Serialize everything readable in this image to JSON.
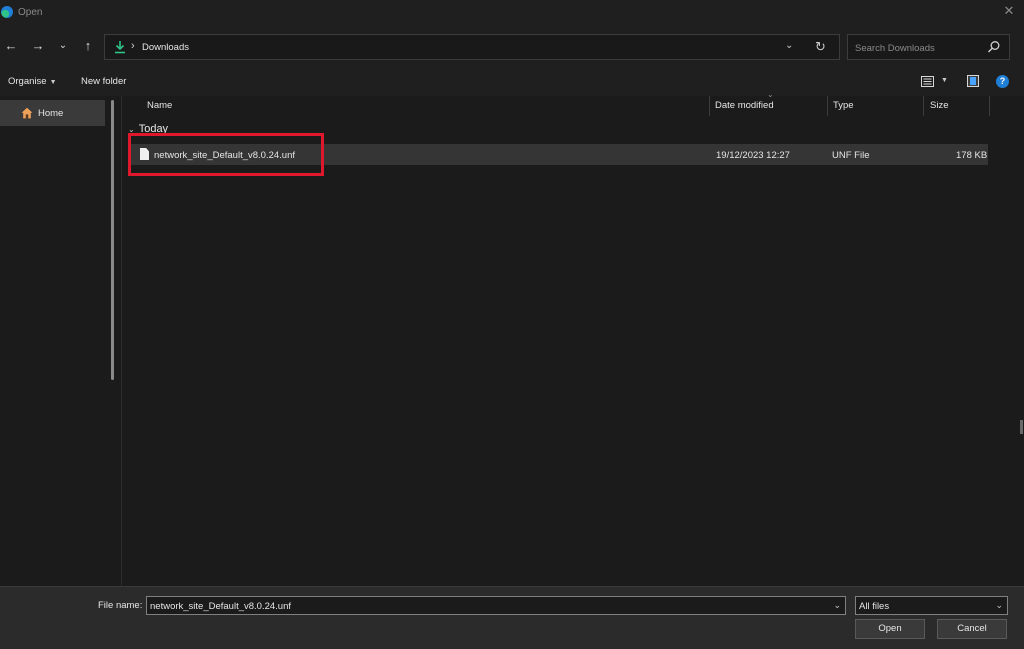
{
  "window": {
    "title": "Open"
  },
  "address_bar": {
    "location": "Downloads"
  },
  "search": {
    "placeholder": "Search Downloads"
  },
  "toolbar": {
    "organise_label": "Organise",
    "new_folder_label": "New folder"
  },
  "sidebar": {
    "items": [
      {
        "label": "Home",
        "icon": "home-icon"
      }
    ]
  },
  "file_list": {
    "columns": [
      "Name",
      "Date modified",
      "Type",
      "Size"
    ],
    "groups": [
      {
        "label": "Today",
        "files": [
          {
            "name": "network_site_Default_v8.0.24.unf",
            "date_modified": "19/12/2023 12:27",
            "type": "UNF File",
            "size": "178 KB"
          }
        ]
      }
    ]
  },
  "footer": {
    "file_name_label": "File name:",
    "file_name_value": "network_site_Default_v8.0.24.unf",
    "file_type_value": "All files",
    "open_label": "Open",
    "cancel_label": "Cancel"
  },
  "colors": {
    "accent": "#1f7fd6",
    "highlight_box": "#e0182d",
    "download_green": "#2fc38a"
  }
}
